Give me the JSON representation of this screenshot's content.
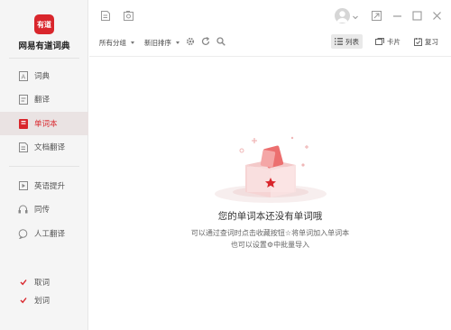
{
  "app": {
    "logo_text": "有道",
    "name": "网易有道词典"
  },
  "sidebar": {
    "items": [
      {
        "label": "词典",
        "icon": "dictionary-icon"
      },
      {
        "label": "翻译",
        "icon": "translate-icon"
      },
      {
        "label": "单词本",
        "icon": "wordbook-icon",
        "active": true
      },
      {
        "label": "文档翻译",
        "icon": "doc-translate-icon"
      },
      {
        "label": "英语提升",
        "icon": "play-icon"
      },
      {
        "label": "同传",
        "icon": "headset-icon"
      },
      {
        "label": "人工翻译",
        "icon": "chat-icon"
      }
    ],
    "checks": [
      {
        "label": "取词",
        "checked": true
      },
      {
        "label": "划词",
        "checked": true
      }
    ]
  },
  "toolbar": {
    "group_label": "所有分组",
    "sort_label": "新旧排序",
    "list_label": "列表",
    "card_label": "卡片",
    "review_label": "复习"
  },
  "empty": {
    "title": "您的单词本还没有单词哦",
    "line1": "可以通过查词时点击收藏按钮☆将单词加入单词本",
    "line2": "也可以设置⚙中批量导入"
  },
  "colors": {
    "brand": "#d9262c",
    "active_bg": "#eae3e3"
  }
}
